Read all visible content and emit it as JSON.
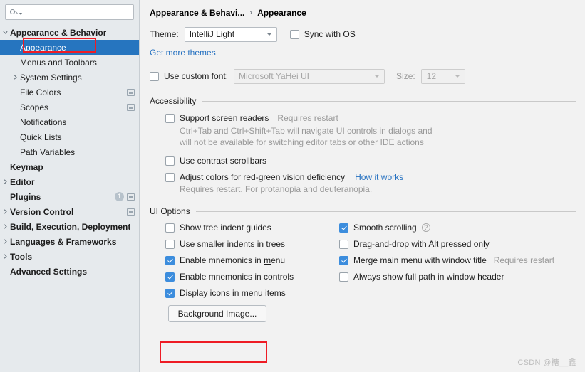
{
  "search": {
    "value": "",
    "placeholder": ""
  },
  "sidebar": {
    "items": [
      {
        "label": "Appearance & Behavior",
        "level": 0,
        "bold": true,
        "arrow": "chevron-down",
        "selected": false,
        "badge": null,
        "settings_icon": false
      },
      {
        "label": "Appearance",
        "level": 1,
        "bold": false,
        "arrow": "none",
        "selected": true,
        "badge": null,
        "settings_icon": false
      },
      {
        "label": "Menus and Toolbars",
        "level": 1,
        "bold": false,
        "arrow": "none",
        "selected": false,
        "badge": null,
        "settings_icon": false
      },
      {
        "label": "System Settings",
        "level": 1,
        "bold": false,
        "arrow": "chevron-right",
        "selected": false,
        "badge": null,
        "settings_icon": false
      },
      {
        "label": "File Colors",
        "level": 1,
        "bold": false,
        "arrow": "none",
        "selected": false,
        "badge": null,
        "settings_icon": true
      },
      {
        "label": "Scopes",
        "level": 1,
        "bold": false,
        "arrow": "none",
        "selected": false,
        "badge": null,
        "settings_icon": true
      },
      {
        "label": "Notifications",
        "level": 1,
        "bold": false,
        "arrow": "none",
        "selected": false,
        "badge": null,
        "settings_icon": false
      },
      {
        "label": "Quick Lists",
        "level": 1,
        "bold": false,
        "arrow": "none",
        "selected": false,
        "badge": null,
        "settings_icon": false
      },
      {
        "label": "Path Variables",
        "level": 1,
        "bold": false,
        "arrow": "none",
        "selected": false,
        "badge": null,
        "settings_icon": false
      },
      {
        "label": "Keymap",
        "level": 0,
        "bold": true,
        "arrow": "none",
        "selected": false,
        "badge": null,
        "settings_icon": false
      },
      {
        "label": "Editor",
        "level": 0,
        "bold": true,
        "arrow": "chevron-right",
        "selected": false,
        "badge": null,
        "settings_icon": false
      },
      {
        "label": "Plugins",
        "level": 0,
        "bold": true,
        "arrow": "none",
        "selected": false,
        "badge": "1",
        "settings_icon": true
      },
      {
        "label": "Version Control",
        "level": 0,
        "bold": true,
        "arrow": "chevron-right",
        "selected": false,
        "badge": null,
        "settings_icon": true
      },
      {
        "label": "Build, Execution, Deployment",
        "level": 0,
        "bold": true,
        "arrow": "chevron-right",
        "selected": false,
        "badge": null,
        "settings_icon": false
      },
      {
        "label": "Languages & Frameworks",
        "level": 0,
        "bold": true,
        "arrow": "chevron-right",
        "selected": false,
        "badge": null,
        "settings_icon": false
      },
      {
        "label": "Tools",
        "level": 0,
        "bold": true,
        "arrow": "chevron-right",
        "selected": false,
        "badge": null,
        "settings_icon": false
      },
      {
        "label": "Advanced Settings",
        "level": 0,
        "bold": true,
        "arrow": "none",
        "selected": false,
        "badge": null,
        "settings_icon": false
      }
    ]
  },
  "breadcrumb": {
    "parent": "Appearance & Behavi...",
    "separator": "›",
    "current": "Appearance"
  },
  "theme": {
    "label": "Theme:",
    "value": "IntelliJ Light",
    "sync_label": "Sync with OS",
    "sync_checked": false,
    "get_more_themes": "Get more themes"
  },
  "custom_font": {
    "label": "Use custom font:",
    "checked": false,
    "font_value": "Microsoft YaHei UI",
    "size_label": "Size:",
    "size_value": "12"
  },
  "accessibility": {
    "title": "Accessibility",
    "screen_readers": {
      "label": "Support screen readers",
      "note": "Requires restart",
      "checked": false,
      "desc_line1": "Ctrl+Tab and Ctrl+Shift+Tab will navigate UI controls in dialogs and",
      "desc_line2": "will not be available for switching editor tabs or other IDE actions"
    },
    "contrast_scrollbars": {
      "label": "Use contrast scrollbars",
      "checked": false
    },
    "red_green": {
      "label": "Adjust colors for red-green vision deficiency",
      "link": "How it works",
      "checked": false,
      "desc": "Requires restart. For protanopia and deuteranopia."
    }
  },
  "ui_options": {
    "title": "UI Options",
    "left_column": [
      {
        "label": "Show tree indent guides",
        "checked": false,
        "mnemonic": null
      },
      {
        "label": "Use smaller indents in trees",
        "checked": false,
        "mnemonic": null
      },
      {
        "label": "Enable mnemonics in menu",
        "checked": true,
        "mnemonic": "m"
      },
      {
        "label": "Enable mnemonics in controls",
        "checked": true,
        "mnemonic": null
      },
      {
        "label": "Display icons in menu items",
        "checked": true,
        "mnemonic": null
      }
    ],
    "right_column": [
      {
        "label": "Smooth scrolling",
        "checked": true,
        "help": true,
        "note": null
      },
      {
        "label": "Drag-and-drop with Alt pressed only",
        "checked": false,
        "help": false,
        "note": null
      },
      {
        "label": "Merge main menu with window title",
        "checked": true,
        "help": false,
        "note": "Requires restart"
      },
      {
        "label": "Always show full path in window header",
        "checked": false,
        "help": false,
        "note": null
      }
    ],
    "background_image_button": "Background Image..."
  },
  "watermark": "CSDN @糖__鑫",
  "colors": {
    "selection_blue": "#2675bf",
    "checkbox_blue": "#3c8ddd",
    "link_blue": "#2470c0",
    "annotation_red": "#ee1c25",
    "sidebar_bg": "#e6eaed",
    "content_bg": "#f2f2f2"
  }
}
